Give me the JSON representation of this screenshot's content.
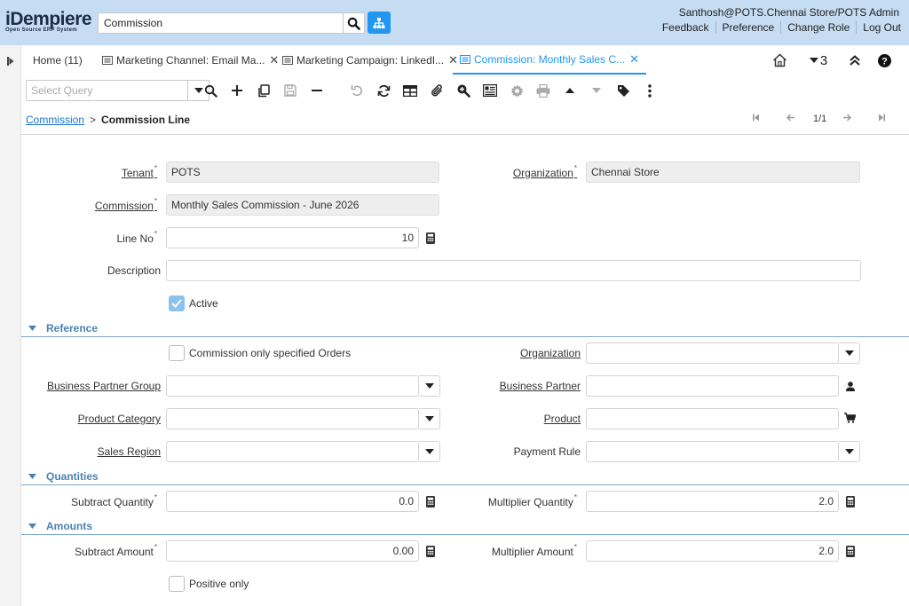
{
  "header": {
    "logo_main": "iDempiere",
    "logo_sub": "Open Source  ERP System",
    "search_value": "Commission",
    "user": "Santhosh@POTS.Chennai Store/POTS Admin",
    "links": [
      "Feedback",
      "Preference",
      "Change Role",
      "Log Out"
    ]
  },
  "tabs": {
    "home": "Home (11)",
    "t1": "Marketing Channel: Email Ma...",
    "t2": "Marketing Campaign: LinkedI...",
    "t3": "Commission: Monthly Sales C...",
    "window_count": "3"
  },
  "toolbar": {
    "query_placeholder": "Select Query"
  },
  "breadcrumb": {
    "parent": "Commission",
    "separator": ">",
    "current": "Commission Line",
    "record_count": "1/1"
  },
  "form": {
    "tenant_label": "Tenant",
    "tenant_value": "POTS",
    "organization_label": "Organization",
    "organization_value": "Chennai Store",
    "commission_label": "Commission",
    "commission_value": "Monthly Sales Commission - June 2026",
    "line_no_label": "Line No",
    "line_no_value": "10",
    "description_label": "Description",
    "description_value": "",
    "active_label": "Active",
    "active_checked": true
  },
  "sections": {
    "reference": "Reference",
    "quantities": "Quantities",
    "amounts": "Amounts"
  },
  "reference": {
    "only_specified_orders_label": "Commission only specified Orders",
    "only_specified_orders_checked": false,
    "organization_label": "Organization",
    "bp_group_label": "Business Partner Group",
    "bp_label": "Business Partner",
    "product_category_label": "Product Category",
    "product_label": "Product",
    "sales_region_label": "Sales Region",
    "payment_rule_label": "Payment Rule"
  },
  "quantities": {
    "subtract_qty_label": "Subtract Quantity",
    "subtract_qty_value": "0.0",
    "multiplier_qty_label": "Multiplier Quantity",
    "multiplier_qty_value": "2.0"
  },
  "amounts": {
    "subtract_amt_label": "Subtract Amount",
    "subtract_amt_value": "0.00",
    "multiplier_amt_label": "Multiplier Amount",
    "multiplier_amt_value": "2.0",
    "positive_only_label": "Positive only",
    "positive_only_checked": false
  },
  "colors": {
    "header_bg": "#c5dcf2",
    "accent": "#2196f3",
    "section_title": "#4a83b4"
  },
  "icons": [
    "search-icon",
    "org-tree-icon",
    "home-icon",
    "window-icon",
    "help-icon",
    "calculator-icon",
    "person-icon",
    "cart-icon",
    "chevron-down-icon"
  ]
}
